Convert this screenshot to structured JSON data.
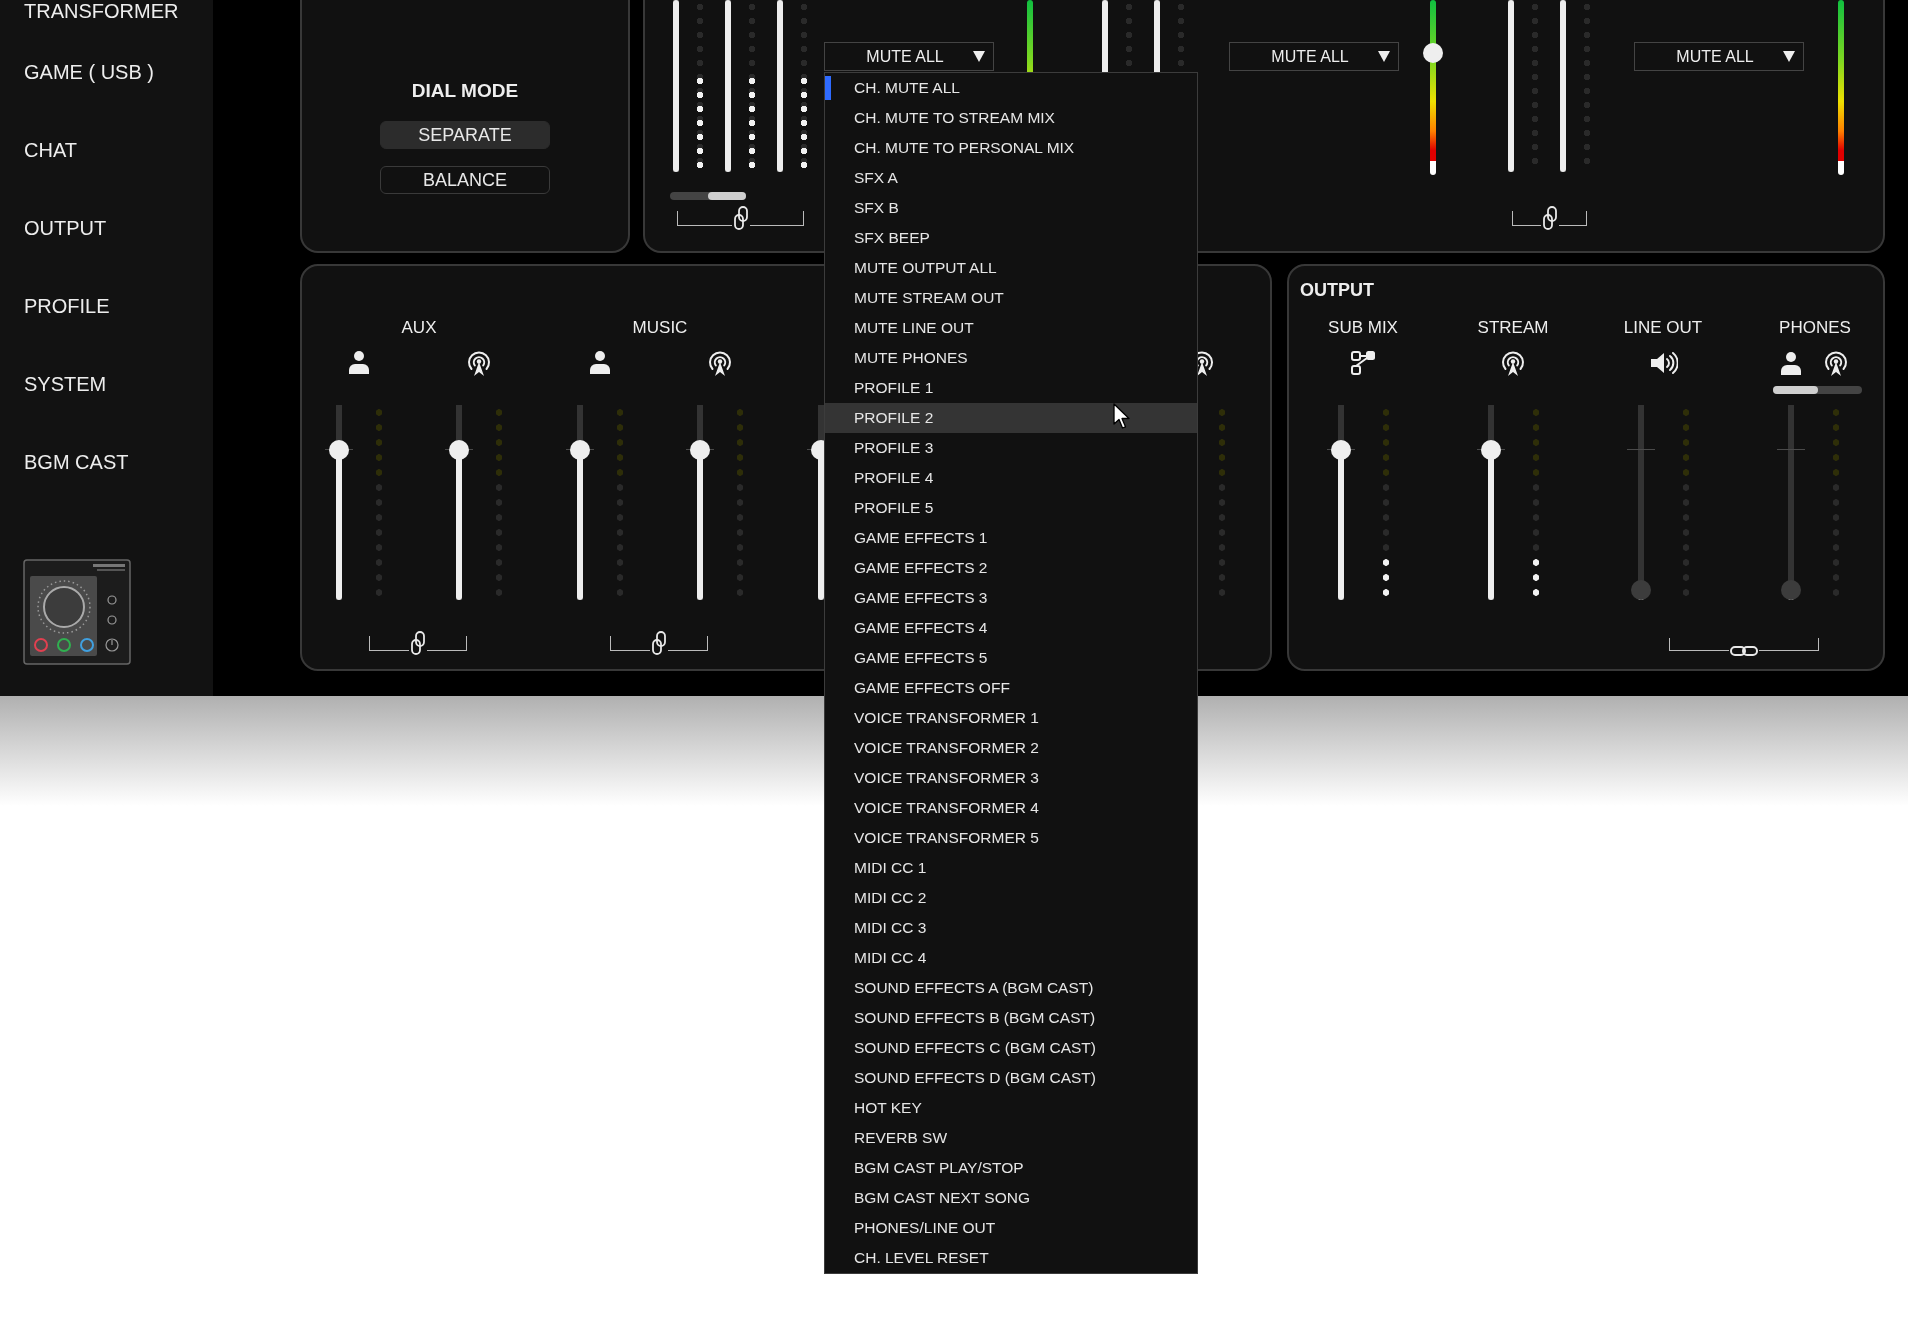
{
  "sidebar": {
    "items": [
      {
        "label": "TRANSFORMER"
      },
      {
        "label": "GAME ( USB )"
      },
      {
        "label": "CHAT"
      },
      {
        "label": "OUTPUT"
      },
      {
        "label": "PROFILE"
      },
      {
        "label": "SYSTEM"
      },
      {
        "label": "BGM CAST"
      }
    ]
  },
  "dial_mode": {
    "title": "DIAL MODE",
    "options": [
      {
        "label": "SEPARATE",
        "selected": true
      },
      {
        "label": "BALANCE",
        "selected": false
      }
    ]
  },
  "mixer": {
    "sections": [
      {
        "kind": "faders",
        "linked": true,
        "balance": {
          "level": 1
        },
        "strips": [
          {
            "fader": {
              "level": 1
            },
            "meter": {
              "level": 0.6
            }
          },
          {
            "fader": {
              "level": 1
            },
            "meter": {
              "level": 0.6
            }
          },
          {
            "fader": {
              "level": 1
            },
            "meter": {
              "level": 0.6
            }
          }
        ]
      },
      {
        "kind": "dropdown",
        "value": "MUTE ALL"
      },
      {
        "kind": "gain_meter"
      },
      {
        "kind": "faders",
        "strips": [
          {
            "fader": {
              "level": 1
            }
          },
          {
            "fader": {
              "level": 1
            }
          }
        ]
      },
      {
        "kind": "dropdown",
        "value": "MUTE ALL"
      },
      {
        "kind": "gain_meter",
        "knob": {
          "level": 0.72
        }
      },
      {
        "kind": "faders",
        "linked": true,
        "strips": [
          {
            "fader": {
              "level": 1
            }
          },
          {
            "fader": {
              "level": 1
            }
          }
        ]
      },
      {
        "kind": "dropdown",
        "value": "MUTE ALL"
      },
      {
        "kind": "gain_meter"
      }
    ]
  },
  "inputs": {
    "groups": [
      {
        "label": "AUX",
        "linked": true,
        "strips": [
          {
            "kind": "personal",
            "fader": {
              "level": 0.8
            }
          },
          {
            "kind": "stream",
            "fader": {
              "level": 0.8
            }
          }
        ]
      },
      {
        "label": "MUSIC",
        "linked": true,
        "strips": [
          {
            "kind": "personal",
            "fader": {
              "level": 0.8
            }
          },
          {
            "kind": "stream",
            "fader": {
              "level": 0.8
            }
          }
        ]
      },
      {
        "strips": [
          {
            "fader": {
              "level": 0.8
            }
          }
        ]
      },
      {
        "strips": [
          {
            "kind": "stream"
          }
        ]
      }
    ]
  },
  "output": {
    "title": "OUTPUT",
    "linked": true,
    "strips": [
      {
        "kind": "sub_mix",
        "label": "SUB MIX",
        "fader": {
          "level": 0.8
        },
        "meter": {
          "level": 0.25
        }
      },
      {
        "kind": "stream",
        "label": "STREAM",
        "fader": {
          "level": 0.8
        },
        "meter": {
          "level": 0.25
        }
      },
      {
        "kind": "line_out",
        "label": "LINE OUT",
        "fader": {
          "level": 0
        }
      },
      {
        "kind": "phones",
        "label": "PHONES",
        "balance": {
          "level": 0
        },
        "fader": {
          "level": 0
        }
      }
    ]
  },
  "mute_menu": {
    "items": [
      {
        "label": "CH. MUTE ALL",
        "selected": true,
        "hovered": false
      },
      {
        "label": "CH. MUTE TO STREAM MIX",
        "selected": false,
        "hovered": false
      },
      {
        "label": "CH. MUTE TO PERSONAL MIX",
        "selected": false,
        "hovered": false
      },
      {
        "label": "SFX A",
        "selected": false,
        "hovered": false
      },
      {
        "label": "SFX B",
        "selected": false,
        "hovered": false
      },
      {
        "label": "SFX BEEP",
        "selected": false,
        "hovered": false
      },
      {
        "label": "MUTE OUTPUT ALL",
        "selected": false,
        "hovered": false
      },
      {
        "label": "MUTE STREAM OUT",
        "selected": false,
        "hovered": false
      },
      {
        "label": "MUTE LINE OUT",
        "selected": false,
        "hovered": false
      },
      {
        "label": "MUTE PHONES",
        "selected": false,
        "hovered": false
      },
      {
        "label": "PROFILE 1",
        "selected": false,
        "hovered": false
      },
      {
        "label": "PROFILE 2",
        "selected": false,
        "hovered": true
      },
      {
        "label": "PROFILE 3",
        "selected": false,
        "hovered": false
      },
      {
        "label": "PROFILE 4",
        "selected": false,
        "hovered": false
      },
      {
        "label": "PROFILE 5",
        "selected": false,
        "hovered": false
      },
      {
        "label": "GAME EFFECTS 1",
        "selected": false,
        "hovered": false
      },
      {
        "label": "GAME EFFECTS 2",
        "selected": false,
        "hovered": false
      },
      {
        "label": "GAME EFFECTS 3",
        "selected": false,
        "hovered": false
      },
      {
        "label": "GAME EFFECTS 4",
        "selected": false,
        "hovered": false
      },
      {
        "label": "GAME EFFECTS 5",
        "selected": false,
        "hovered": false
      },
      {
        "label": "GAME EFFECTS OFF",
        "selected": false,
        "hovered": false
      },
      {
        "label": "VOICE TRANSFORMER 1",
        "selected": false,
        "hovered": false
      },
      {
        "label": "VOICE TRANSFORMER 2",
        "selected": false,
        "hovered": false
      },
      {
        "label": "VOICE TRANSFORMER 3",
        "selected": false,
        "hovered": false
      },
      {
        "label": "VOICE TRANSFORMER 4",
        "selected": false,
        "hovered": false
      },
      {
        "label": "VOICE TRANSFORMER 5",
        "selected": false,
        "hovered": false
      },
      {
        "label": "MIDI CC 1",
        "selected": false,
        "hovered": false
      },
      {
        "label": "MIDI CC 2",
        "selected": false,
        "hovered": false
      },
      {
        "label": "MIDI CC 3",
        "selected": false,
        "hovered": false
      },
      {
        "label": "MIDI CC 4",
        "selected": false,
        "hovered": false
      },
      {
        "label": "SOUND EFFECTS A (BGM CAST)",
        "selected": false,
        "hovered": false
      },
      {
        "label": "SOUND EFFECTS B (BGM CAST)",
        "selected": false,
        "hovered": false
      },
      {
        "label": "SOUND EFFECTS C (BGM CAST)",
        "selected": false,
        "hovered": false
      },
      {
        "label": "SOUND EFFECTS D (BGM CAST)",
        "selected": false,
        "hovered": false
      },
      {
        "label": "HOT KEY",
        "selected": false,
        "hovered": false
      },
      {
        "label": "REVERB SW",
        "selected": false,
        "hovered": false
      },
      {
        "label": "BGM CAST PLAY/STOP",
        "selected": false,
        "hovered": false
      },
      {
        "label": "BGM CAST NEXT SONG",
        "selected": false,
        "hovered": false
      },
      {
        "label": "PHONES/LINE OUT",
        "selected": false,
        "hovered": false
      },
      {
        "label": "CH. LEVEL RESET",
        "selected": false,
        "hovered": false
      }
    ]
  }
}
